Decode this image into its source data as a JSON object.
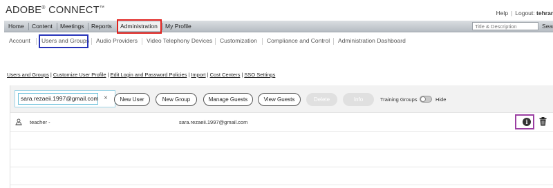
{
  "header": {
    "logo_text": "ADOBE",
    "logo_reg": "®",
    "logo_product": " CONNECT",
    "logo_tm": "™",
    "help": "Help",
    "logout_label": "Logout:",
    "user": "tehran"
  },
  "nav": {
    "items": [
      "Home",
      "Content",
      "Meetings",
      "Reports",
      "Administration",
      "My Profile"
    ],
    "search_placeholder": "Title & Description",
    "search_button": "Search"
  },
  "subnav": {
    "items": [
      "Account",
      "Users and Groups",
      "Audio Providers",
      "Video Telephony Devices",
      "Customization",
      "Compliance and Control",
      "Administration Dashboard"
    ]
  },
  "tabs": {
    "items": [
      "Users and Groups",
      "Customize User Profile",
      "Edit Login and Password Policies",
      "Import",
      "Cost Centers",
      "SSO Settings"
    ]
  },
  "toolbar": {
    "filter_value": "sara.rezaeii.1997@gmail.com",
    "clear": "×",
    "new_user": "New User",
    "new_group": "New Group",
    "manage_guests": "Manage Guests",
    "view_guests": "View Guests",
    "delete": "Delete",
    "info": "Info",
    "training_groups": "Training Groups",
    "hide": "Hide"
  },
  "rows": [
    {
      "name": "teacher -",
      "email": "sara.rezaeii.1997@gmail.com",
      "info_glyph": "i"
    }
  ],
  "colors": {
    "highlight_admin": "#e0201c",
    "highlight_users_groups": "#2633b8",
    "highlight_info": "#9b3fa2"
  }
}
